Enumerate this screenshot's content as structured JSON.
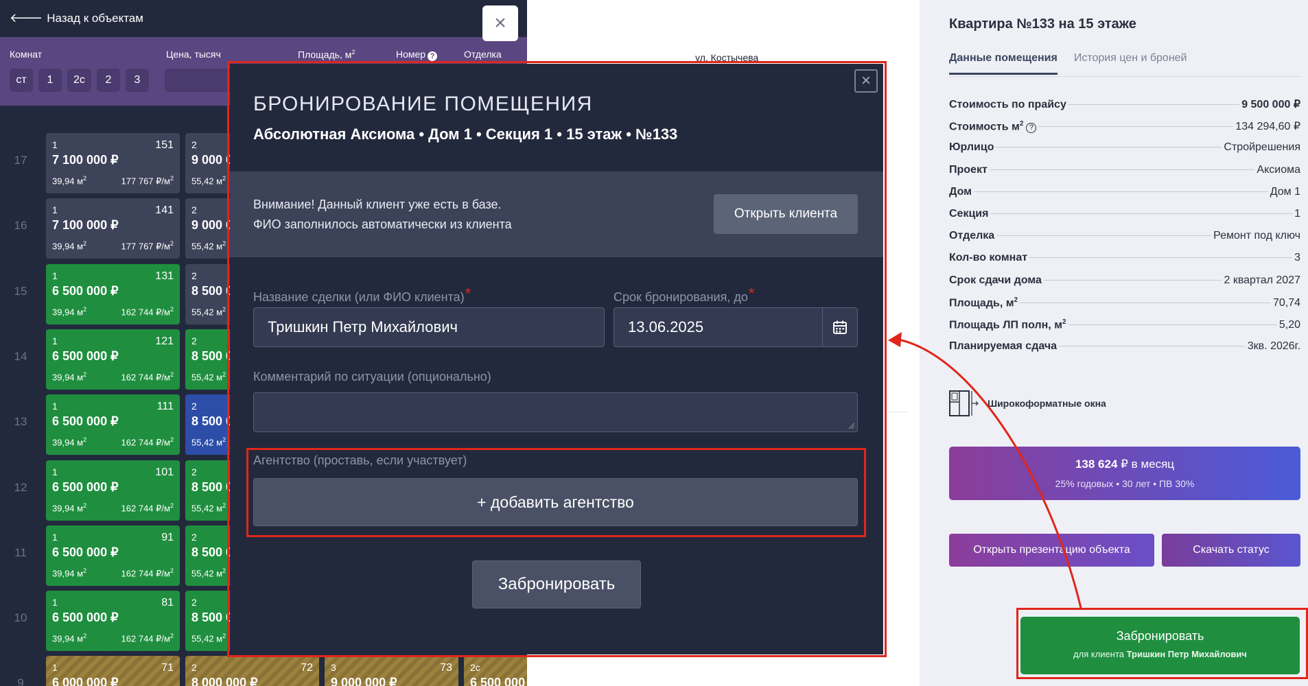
{
  "left_panel": {
    "back_label": "Назад к объектам",
    "close_glyph": "×",
    "filters": {
      "rooms_label": "Комнат",
      "price_label": "Цена, тысяч",
      "area_label": "Площадь, м",
      "area_sup": "2",
      "number_label": "Номер",
      "finish_label": "Отделка",
      "room_options": [
        "ст",
        "1",
        "2с",
        "2",
        "3"
      ]
    },
    "floors": [
      {
        "floor": "17",
        "units": [
          {
            "rooms": "1",
            "num": "151",
            "price": "7 100 000 ₽",
            "area": "39,94 м",
            "ppm": "177 767 ₽/м",
            "status": "grey"
          },
          {
            "rooms": "2",
            "num": "",
            "price": "9 000 0",
            "area": "55,42 м",
            "ppm": "",
            "status": "grey"
          }
        ]
      },
      {
        "floor": "16",
        "units": [
          {
            "rooms": "1",
            "num": "141",
            "price": "7 100 000 ₽",
            "area": "39,94 м",
            "ppm": "177 767 ₽/м",
            "status": "grey"
          },
          {
            "rooms": "2",
            "num": "",
            "price": "9 000 0",
            "area": "55,42 м",
            "ppm": "",
            "status": "grey"
          }
        ]
      },
      {
        "floor": "15",
        "units": [
          {
            "rooms": "1",
            "num": "131",
            "price": "6 500 000 ₽",
            "area": "39,94 м",
            "ppm": "162 744 ₽/м",
            "status": "green"
          },
          {
            "rooms": "2",
            "num": "",
            "price": "8 500 0",
            "area": "55,42 м",
            "ppm": "",
            "status": "grey"
          }
        ]
      },
      {
        "floor": "14",
        "units": [
          {
            "rooms": "1",
            "num": "121",
            "price": "6 500 000 ₽",
            "area": "39,94 м",
            "ppm": "162 744 ₽/м",
            "status": "green"
          },
          {
            "rooms": "2",
            "num": "",
            "price": "8 500 0",
            "area": "55,42 м",
            "ppm": "",
            "status": "green"
          }
        ]
      },
      {
        "floor": "13",
        "units": [
          {
            "rooms": "1",
            "num": "111",
            "price": "6 500 000 ₽",
            "area": "39,94 м",
            "ppm": "162 744 ₽/м",
            "status": "green"
          },
          {
            "rooms": "2",
            "num": "",
            "price": "8 500 0",
            "area": "55,42 м",
            "ppm": "",
            "status": "blue"
          }
        ]
      },
      {
        "floor": "12",
        "units": [
          {
            "rooms": "1",
            "num": "101",
            "price": "6 500 000 ₽",
            "area": "39,94 м",
            "ppm": "162 744 ₽/м",
            "status": "green"
          },
          {
            "rooms": "2",
            "num": "",
            "price": "8 500 0",
            "area": "55,42 м",
            "ppm": "",
            "status": "green"
          }
        ]
      },
      {
        "floor": "11",
        "units": [
          {
            "rooms": "1",
            "num": "91",
            "price": "6 500 000 ₽",
            "area": "39,94 м",
            "ppm": "162 744 ₽/м",
            "status": "green"
          },
          {
            "rooms": "2",
            "num": "",
            "price": "8 500 0",
            "area": "55,42 м",
            "ppm": "",
            "status": "green"
          }
        ]
      },
      {
        "floor": "10",
        "units": [
          {
            "rooms": "1",
            "num": "81",
            "price": "6 500 000 ₽",
            "area": "39,94 м",
            "ppm": "162 744 ₽/м",
            "status": "green"
          },
          {
            "rooms": "2",
            "num": "",
            "price": "8 500 0",
            "area": "55,42 м",
            "ppm": "",
            "status": "green"
          }
        ]
      },
      {
        "floor": "9",
        "units": [
          {
            "rooms": "1",
            "num": "71",
            "price": "6 000 000 ₽",
            "area": "",
            "ppm": "",
            "status": "gold"
          },
          {
            "rooms": "2",
            "num": "72",
            "price": "8 000 000 ₽",
            "area": "",
            "ppm": "",
            "status": "gold"
          },
          {
            "rooms": "3",
            "num": "73",
            "price": "9 000 000 ₽",
            "area": "",
            "ppm": "",
            "status": "gold"
          },
          {
            "rooms": "2с",
            "num": "",
            "price": "6 500 000",
            "area": "",
            "ppm": "",
            "status": "gold"
          }
        ]
      }
    ],
    "sup2": "2"
  },
  "center": {
    "street": "ул. Костычева"
  },
  "right_panel": {
    "title": "Квартира №133 на 15 этаже",
    "tabs": [
      {
        "label": "Данные помещения",
        "active": true
      },
      {
        "label": "История цен и броней",
        "active": false
      }
    ],
    "props": [
      {
        "key": "Стоимость по прайсу",
        "value": "9 500 000 ₽",
        "bold": true
      },
      {
        "key": "Стоимость м",
        "sup": "2",
        "help": "?",
        "value": "134 294,60 ₽"
      },
      {
        "key": "Юрлицо",
        "value": "Стройрешения"
      },
      {
        "key": "Проект",
        "value": "Аксиома"
      },
      {
        "key": "Дом",
        "value": "Дом 1"
      },
      {
        "key": "Секция",
        "value": "1"
      },
      {
        "key": "Отделка",
        "value": "Ремонт под ключ"
      },
      {
        "key": "Кол-во комнат",
        "value": "3"
      },
      {
        "key": "Срок сдачи дома",
        "value": "2 квартал 2027"
      },
      {
        "key": "Площадь, м",
        "sup": "2",
        "value": "70,74"
      },
      {
        "key": "Площадь ЛП полн, м",
        "sup": "2",
        "value": "5,20"
      },
      {
        "key": "Планируемая сдача",
        "value": "3кв. 2026г."
      }
    ],
    "feature_label": "Широкоформатные окна",
    "mortgage": {
      "amount": "138 624",
      "suffix": " ₽ в месяц",
      "details": "25% годовых • 30 лет • ПВ 30%"
    },
    "presentation_label": "Открыть презентацию объекта",
    "status_label": "Скачать статус",
    "book": {
      "label": "Забронировать",
      "for_prefix": "для клиента ",
      "client": "Тришкин Петр Михайлович"
    }
  },
  "modal": {
    "close_glyph": "×",
    "title": "БРОНИРОВАНИЕ ПОМЕЩЕНИЯ",
    "subtitle": "Абсолютная Аксиома • Дом 1 • Секция 1 • 15 этаж • №133",
    "notice_line1": "Внимание! Данный клиент уже есть в базе.",
    "notice_line2": "ФИО заполнилось автоматически из клиента",
    "open_client_label": "Открыть клиента",
    "deal_label": "Название сделки (или ФИО клиента)",
    "deal_value": "Тришкин Петр Михайлович",
    "date_label": "Срок бронирования, до",
    "date_value": "13.06.2025",
    "required_mark": "*",
    "comment_label": "Комментарий по ситуации (опционально)",
    "agency_label": "Агентство (проставь, если участвует)",
    "add_agency_label": "+ добавить агентство",
    "submit_label": "Забронировать"
  },
  "colors": {
    "accent_red": "#e0261a",
    "available_green": "#1f8f3f",
    "modal_bg": "#23293d"
  }
}
